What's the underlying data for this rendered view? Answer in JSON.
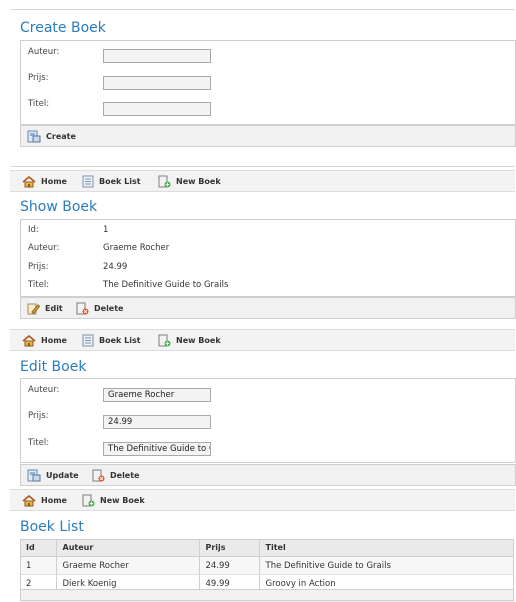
{
  "create": {
    "title": "Create Boek",
    "fields": [
      {
        "label": "Auteur:",
        "value": ""
      },
      {
        "label": "Prijs:",
        "value": ""
      },
      {
        "label": "Titel:",
        "value": ""
      }
    ],
    "create_label": "Create"
  },
  "nav": {
    "home": "Home",
    "boek_list": "Boek List",
    "new_boek": "New Boek"
  },
  "show": {
    "title": "Show Boek",
    "rows": [
      {
        "label": "Id:",
        "value": "1"
      },
      {
        "label": "Auteur:",
        "value": "Graeme Rocher"
      },
      {
        "label": "Prijs:",
        "value": "24.99"
      },
      {
        "label": "Titel:",
        "value": "The Definitive Guide to Grails"
      }
    ],
    "edit_label": "Edit",
    "delete_label": "Delete"
  },
  "edit": {
    "title": "Edit Boek",
    "fields": [
      {
        "label": "Auteur:",
        "value": "Graeme Rocher"
      },
      {
        "label": "Prijs:",
        "value": "24.99"
      },
      {
        "label": "Titel:",
        "value": "The Definitive Guide to Grails"
      }
    ],
    "update_label": "Update",
    "delete_label": "Delete"
  },
  "list": {
    "title": "Boek List",
    "columns": [
      "Id",
      "Auteur",
      "Prijs",
      "Titel"
    ],
    "rows": [
      [
        "1",
        "Graeme Rocher",
        "24.99",
        "The Definitive Guide to Grails"
      ],
      [
        "2",
        "Dierk Koenig",
        "49.99",
        "Groovy in Action"
      ]
    ]
  },
  "colors": {
    "title": "#2a7cbd",
    "bar": "#f1f1f1",
    "border": "#cfcfcf"
  },
  "icons": {
    "home": "house-icon",
    "list": "list-icon",
    "new": "new-document-icon",
    "save": "save-icon",
    "edit": "pencil-icon",
    "delete": "delete-icon"
  }
}
